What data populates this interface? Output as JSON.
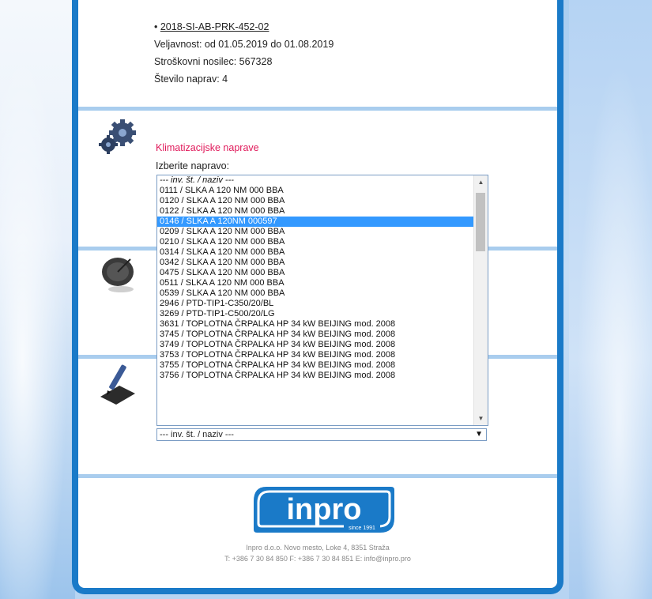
{
  "document": {
    "code": "2018-SI-AB-PRK-452-02",
    "validity": "Veljavnost: od 01.05.2019 do 01.08.2019",
    "cost_center": "Stroškovni nosilec: 567328",
    "device_count": "Število naprav: 4"
  },
  "section": {
    "title": "Klimatizacijske naprave",
    "select_label": "Izberite napravo:"
  },
  "listbox": {
    "options": [
      "--- inv. št. / naziv ---",
      "0111 / SLKA A 120 NM 000 BBA",
      "0120 / SLKA A 120 NM 000 BBA",
      "0122 / SLKA A 120 NM 000 BBA",
      "0146 / SLKA A 120NM 000597",
      "0209 / SLKA A 120 NM 000 BBA",
      "0210 / SLKA A 120 NM 000 BBA",
      "0314 / SLKA A 120 NM 000 BBA",
      "0342 / SLKA A 120 NM 000 BBA",
      "0475 / SLKA A 120 NM 000 BBA",
      "0511 / SLKA A 120 NM 000 BBA",
      "0539 / SLKA A 120 NM 000 BBA",
      "2946 / PTD-TIP1-C350/20/BL",
      "3269 / PTD-TIP1-C500/20/LG",
      "3631 / TOPLOTNA ČRPALKA HP 34 kW BEIJING mod. 2008",
      "3745 / TOPLOTNA ČRPALKA HP 34 kW BEIJING mod. 2008",
      "3749 / TOPLOTNA ČRPALKA HP 34 kW BEIJING mod. 2008",
      "3753 / TOPLOTNA ČRPALKA HP 34 kW BEIJING mod. 2008",
      "3755 / TOPLOTNA ČRPALKA HP 34 kW BEIJING mod. 2008",
      "3756 / TOPLOTNA ČRPALKA HP 34 kW BEIJING mod. 2008"
    ],
    "selected_value": "0146 / SLKA A 120NM 000597"
  },
  "dropdown": {
    "selected": "--- inv. št. / naziv ---"
  },
  "footer": {
    "logo_text": "inpro",
    "logo_tagline": "since 1991",
    "address": "Inpro d.o.o. Novo mesto, Loke 4, 8351 Straža",
    "contacts": "T: +386 7 30 84 850   F: +386 7 30 84 851   E: info@inpro.pro"
  },
  "icons": {
    "gears": "gears-icon",
    "satellite": "satellite-dish-icon",
    "signature": "pen-signature-icon",
    "scroll_up": "triangle-up",
    "scroll_down": "triangle-down",
    "dropdown_arrow": "triangle-down"
  },
  "colors": {
    "brand_blue": "#1a7ac8",
    "section_title": "#e0195a",
    "selection": "#3399ff"
  }
}
